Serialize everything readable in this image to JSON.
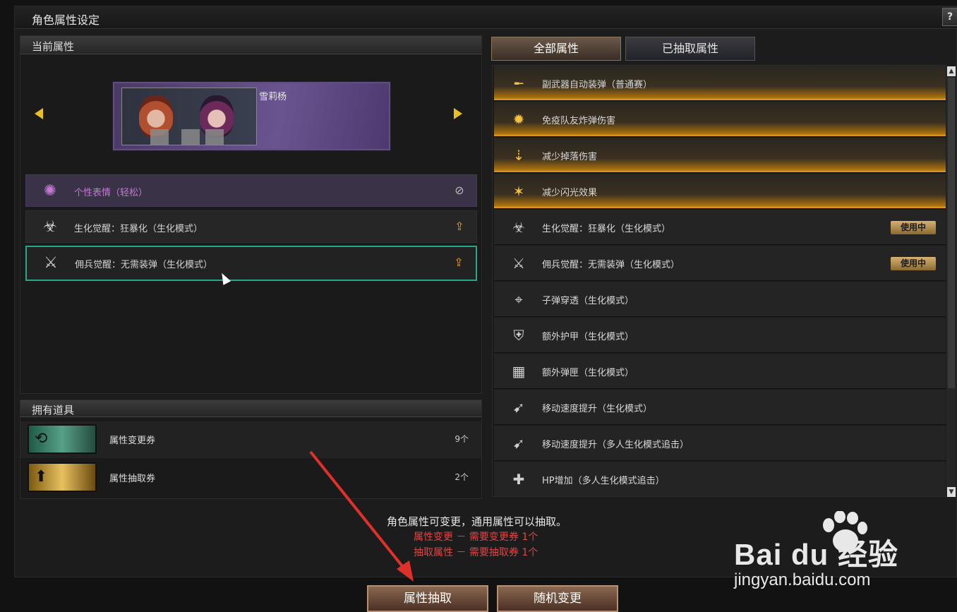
{
  "window": {
    "title": "角色属性设定",
    "help_label": "?"
  },
  "current_attrs": {
    "header": "当前属性",
    "character_name": "雪莉杨",
    "rows": [
      {
        "label": "个性表情（轻松）",
        "icon": "emote-icon",
        "action_icon": "ban-icon",
        "style": "purple"
      },
      {
        "label": "生化觉醒：狂暴化（生化模式）",
        "icon": "bio-awaken-icon",
        "action_icon": "upgrade-icon",
        "style": "normal"
      },
      {
        "label": "佣兵觉醒：无需装弹（生化模式）",
        "icon": "mercenary-icon",
        "action_icon": "upgrade-icon",
        "style": "selected"
      }
    ]
  },
  "items": {
    "header": "拥有道具",
    "rows": [
      {
        "name": "属性变更券",
        "count": "9个",
        "thumb": "green"
      },
      {
        "name": "属性抽取券",
        "count": "2个",
        "thumb": "gold"
      }
    ]
  },
  "tabs": {
    "all": "全部属性",
    "extracted": "已抽取属性"
  },
  "attr_list": [
    {
      "label": "副武器自动装弹（普通赛）",
      "icon": "pistol-icon",
      "gold": true,
      "badge": ""
    },
    {
      "label": "免疫队友炸弹伤害",
      "icon": "explosion-icon",
      "gold": true,
      "badge": ""
    },
    {
      "label": "减少掉落伤害",
      "icon": "fall-icon",
      "gold": true,
      "badge": ""
    },
    {
      "label": "减少闪光效果",
      "icon": "flash-icon",
      "gold": true,
      "badge": ""
    },
    {
      "label": "生化觉醒：狂暴化（生化模式）",
      "icon": "bio-awaken-icon",
      "gold": false,
      "badge": "使用中"
    },
    {
      "label": "佣兵觉醒：无需装弹（生化模式）",
      "icon": "mercenary-icon",
      "gold": false,
      "badge": "使用中"
    },
    {
      "label": "子弹穿透（生化模式）",
      "icon": "crosshair-icon",
      "gold": false,
      "badge": ""
    },
    {
      "label": "额外护甲（生化模式）",
      "icon": "armor-icon",
      "gold": false,
      "badge": ""
    },
    {
      "label": "额外弹匣（生化模式）",
      "icon": "magazine-icon",
      "gold": false,
      "badge": ""
    },
    {
      "label": "移动速度提升（生化模式）",
      "icon": "speed-icon",
      "gold": false,
      "badge": ""
    },
    {
      "label": "移动速度提升（多人生化模式追击）",
      "icon": "speed-icon",
      "gold": false,
      "badge": ""
    },
    {
      "label": "HP增加（多人生化模式追击）",
      "icon": "hp-icon",
      "gold": false,
      "badge": ""
    }
  ],
  "info": {
    "line1": "角色属性可变更，通用属性可以抽取。",
    "line2": "属性变更 － 需要变更券 1个",
    "line3": "抽取属性 － 需要抽取券 1个"
  },
  "buttons": {
    "extract": "属性抽取",
    "random_change": "随机变更"
  },
  "watermark": {
    "logo": "Bai du 经验",
    "url": "jingyan.baidu.com"
  },
  "colors": {
    "accent_gold": "#e8a020",
    "selected_border": "#2aa58a",
    "warning_red": "#d84848",
    "purple_text": "#c27ad6"
  }
}
